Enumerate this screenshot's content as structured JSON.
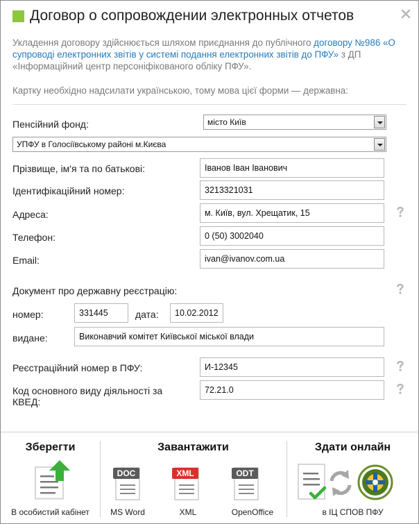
{
  "dialog": {
    "title": "Договор о сопровождении электронных отчетов",
    "close_icon": "close-icon",
    "accent_color": "#8dc63f"
  },
  "intro": {
    "before_link": "Укладення договору здійснюється шляхом приєднання до публічного ",
    "link_text": "договору №986 «О супроводі електронних звітів у системі подання електронних звітів до ПФУ»",
    "after_link": " з ДП «Інформаційний центр персоніфікованого обліку ПФУ».",
    "lang_note": "Картку необхідно надсилати українською, тому мова цієї форми — державна:"
  },
  "form": {
    "pension_fund_label": "Пенсійний фонд:",
    "pension_fund_value": "місто Київ",
    "upfu_value": "УПФУ в Голосіївському районі м.Києва",
    "name_label": "Прізвище, ім'я та по батькові:",
    "name_value": "Іванов Іван Іванович",
    "id_label": "Ідентифікаційний номер:",
    "id_value": "3213321031",
    "address_label": "Адреса:",
    "address_value": "м. Київ, вул. Хрещатик, 15",
    "phone_label": "Телефон:",
    "phone_value": "0 (50) 3002040",
    "email_label": "Email:",
    "email_value": "ivan@ivanov.com.ua",
    "doc_label": "Документ про державну реєстрацію:",
    "number_label": "номер:",
    "number_value": "331445",
    "date_label": "дата:",
    "date_value": "10.02.2012",
    "issued_label": "видане:",
    "issued_value": "Виконавчий комітет Київської міської влади",
    "pfu_reg_label": "Реєстраційний номер в ПФУ:",
    "pfu_reg_value": "И-12345",
    "kved_label": "Код основного виду діяльності за КВЕД:",
    "kved_value": "72.21.0"
  },
  "footer": {
    "save_title": "Зберегти",
    "save_label": "В особистий кабінет",
    "download_title": "Завантажити",
    "doc_badge": "DOC",
    "doc_label": "MS Word",
    "xml_badge": "XML",
    "xml_label": "XML",
    "odt_badge": "ODT",
    "odt_label": "OpenOffice",
    "submit_title": "Здати онлайн",
    "submit_label": "в ІЦ СПОВ ПФУ"
  }
}
